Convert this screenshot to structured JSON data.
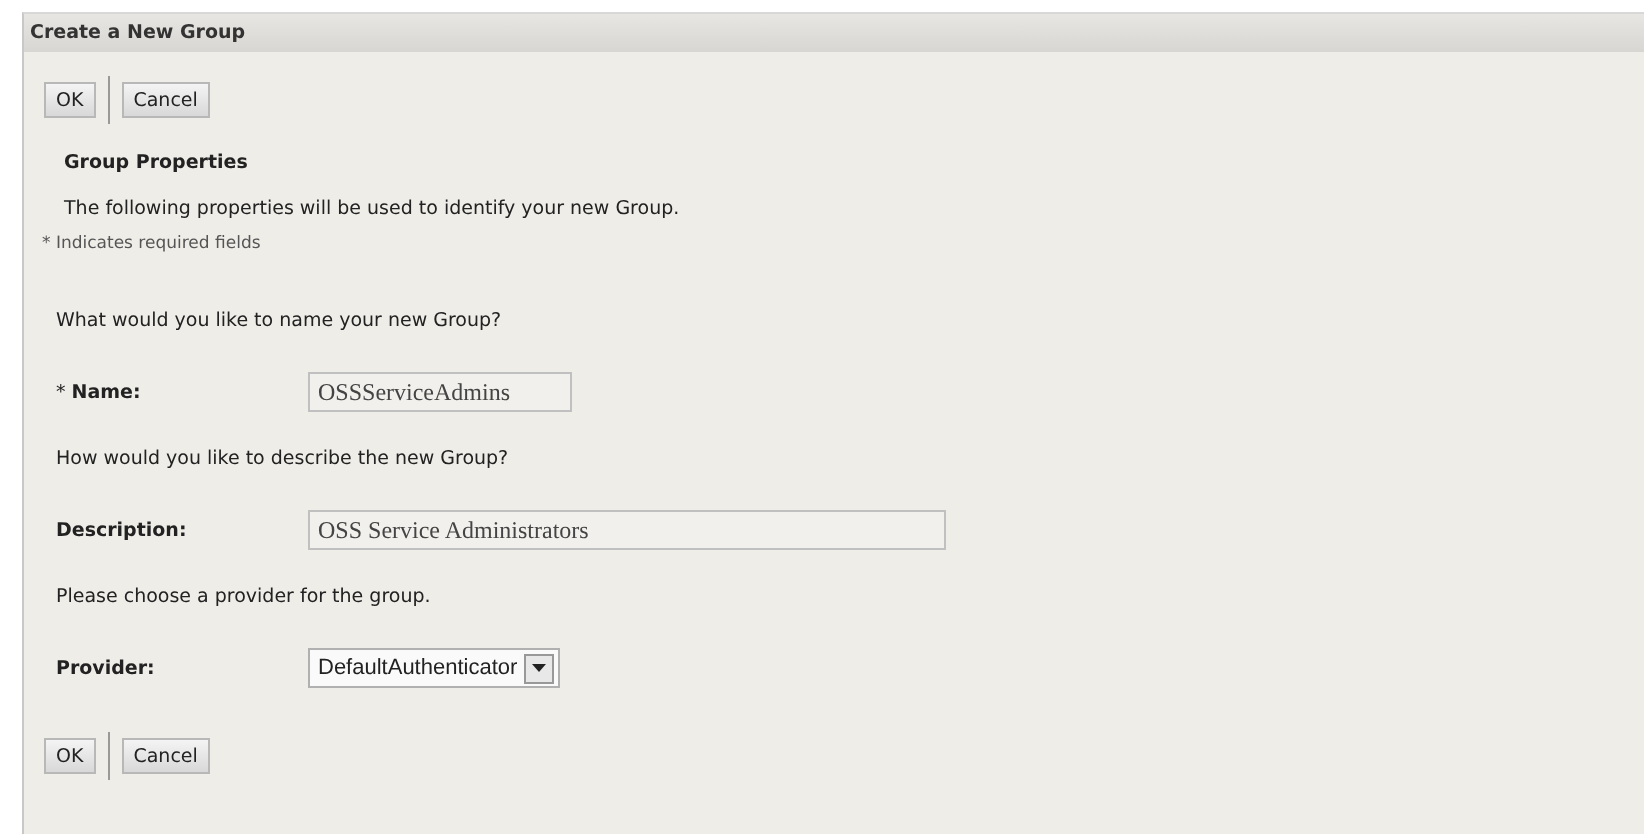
{
  "window": {
    "title": "Create a New Group"
  },
  "top_buttons": [
    "OK",
    "Cancel"
  ],
  "section": {
    "heading": "Group Properties",
    "intro": "The following properties will be used to identify your new Group.",
    "required_note": "* Indicates required fields"
  },
  "fields": [
    {
      "kind": "text",
      "prompt": "What would you like to name your new Group?",
      "label": "Name:",
      "required": true,
      "required_mark": "*",
      "value": "OSSServiceAdmins",
      "wide": false
    },
    {
      "kind": "text",
      "prompt": "How would you like to describe the new Group?",
      "label": "Description:",
      "required": false,
      "value": "OSS Service Administrators",
      "wide": true
    },
    {
      "kind": "select",
      "prompt": "Please choose a provider for the group.",
      "label": "Provider:",
      "required": false,
      "value": "DefaultAuthenticator"
    }
  ],
  "bottom_buttons": [
    "OK",
    "Cancel"
  ]
}
